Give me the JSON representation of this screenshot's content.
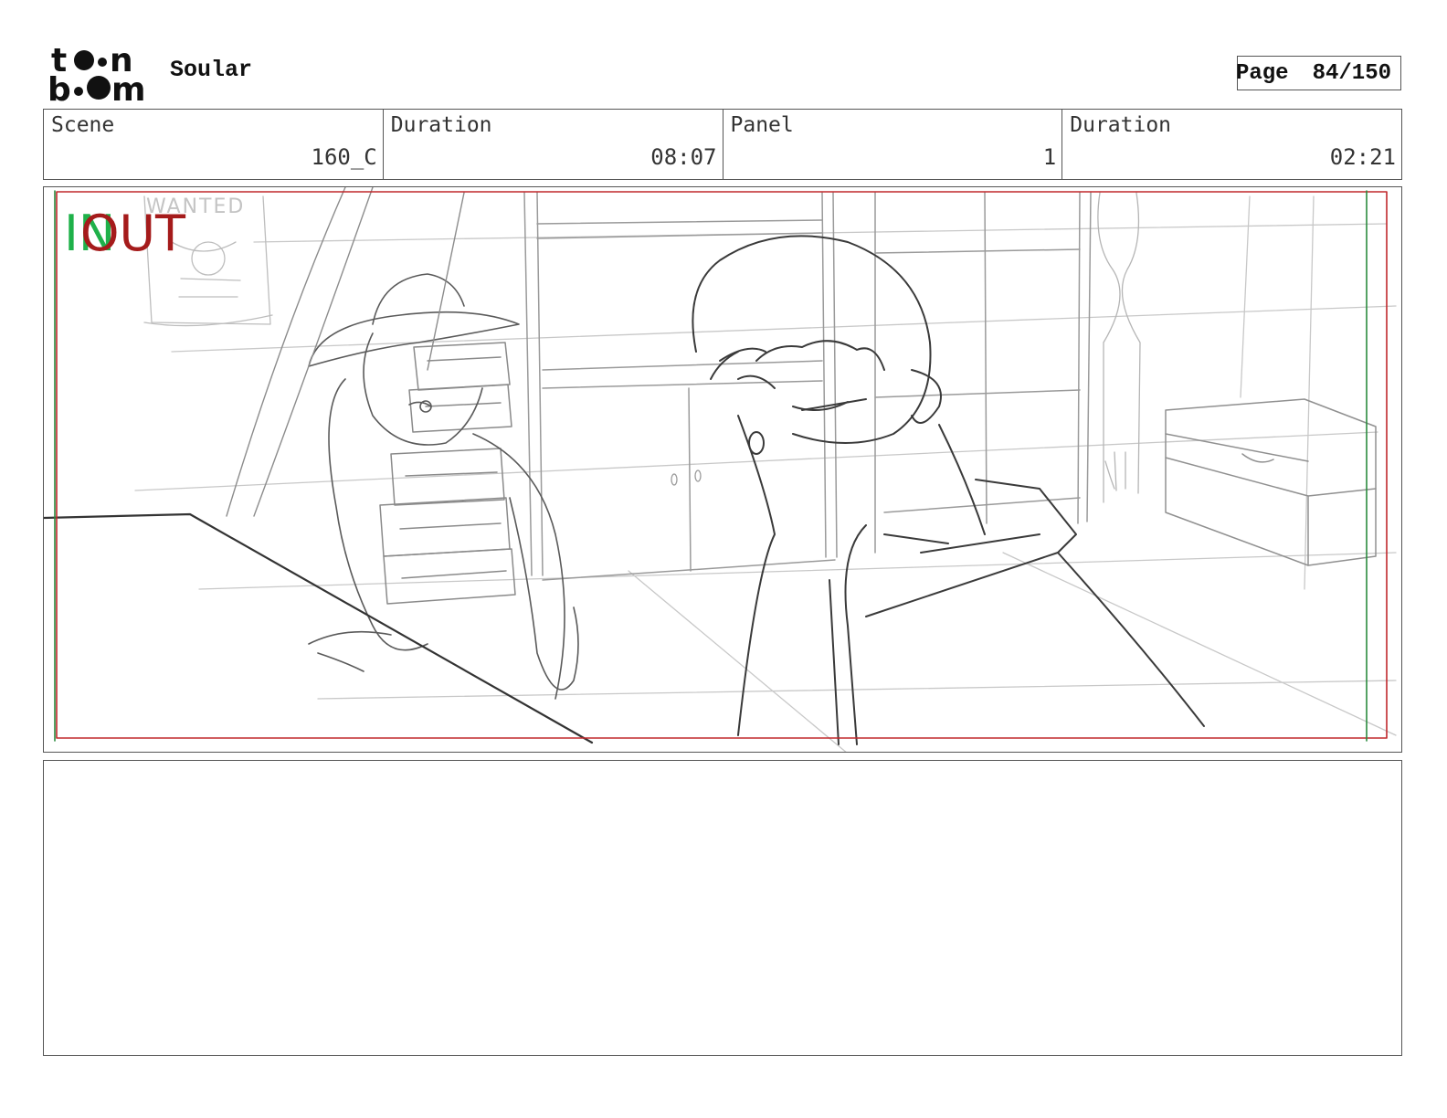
{
  "header": {
    "logo_text_top": "toon",
    "logo_text_bottom": "boom",
    "project_title": "Soular",
    "page_label": "Page",
    "page_number": "84/150"
  },
  "info": [
    {
      "label": "Scene",
      "value": "160_C"
    },
    {
      "label": "Duration",
      "value": "08:07"
    },
    {
      "label": "Panel",
      "value": "1"
    },
    {
      "label": "Duration",
      "value": "02:21"
    }
  ],
  "panel": {
    "in_marker": "IN",
    "out_marker": "OUT",
    "poster_text": "WANTED"
  },
  "notes": {
    "text": ""
  },
  "colors": {
    "in_green": "#1fb14a",
    "out_red": "#a51b1b",
    "safe_frame_red": "#c0282c",
    "safe_frame_green": "#2b8a3e"
  }
}
